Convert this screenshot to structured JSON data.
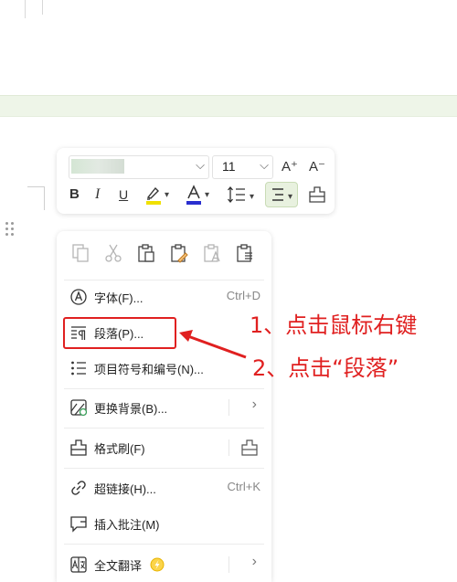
{
  "toolbar": {
    "font_size": "11",
    "grow_label": "A⁺",
    "shrink_label": "A⁻",
    "bold": "B",
    "italic": "I",
    "underline": "U",
    "highlight_color": "#f0e000",
    "font_color": "#2a2fcf"
  },
  "menu": {
    "items": [
      {
        "label": "字体(F)...",
        "shortcut": "Ctrl+D"
      },
      {
        "label": "段落(P)..."
      },
      {
        "label": "项目符号和编号(N)..."
      },
      {
        "label": "更换背景(B)..."
      },
      {
        "label": "格式刷(F)"
      },
      {
        "label": "超链接(H)...",
        "shortcut": "Ctrl+K"
      },
      {
        "label": "插入批注(M)"
      },
      {
        "label": "全文翻译"
      }
    ]
  },
  "annotations": {
    "step1": "1、点击鼠标右键",
    "step2": "2、点击“段落”",
    "color": "#e02020"
  }
}
